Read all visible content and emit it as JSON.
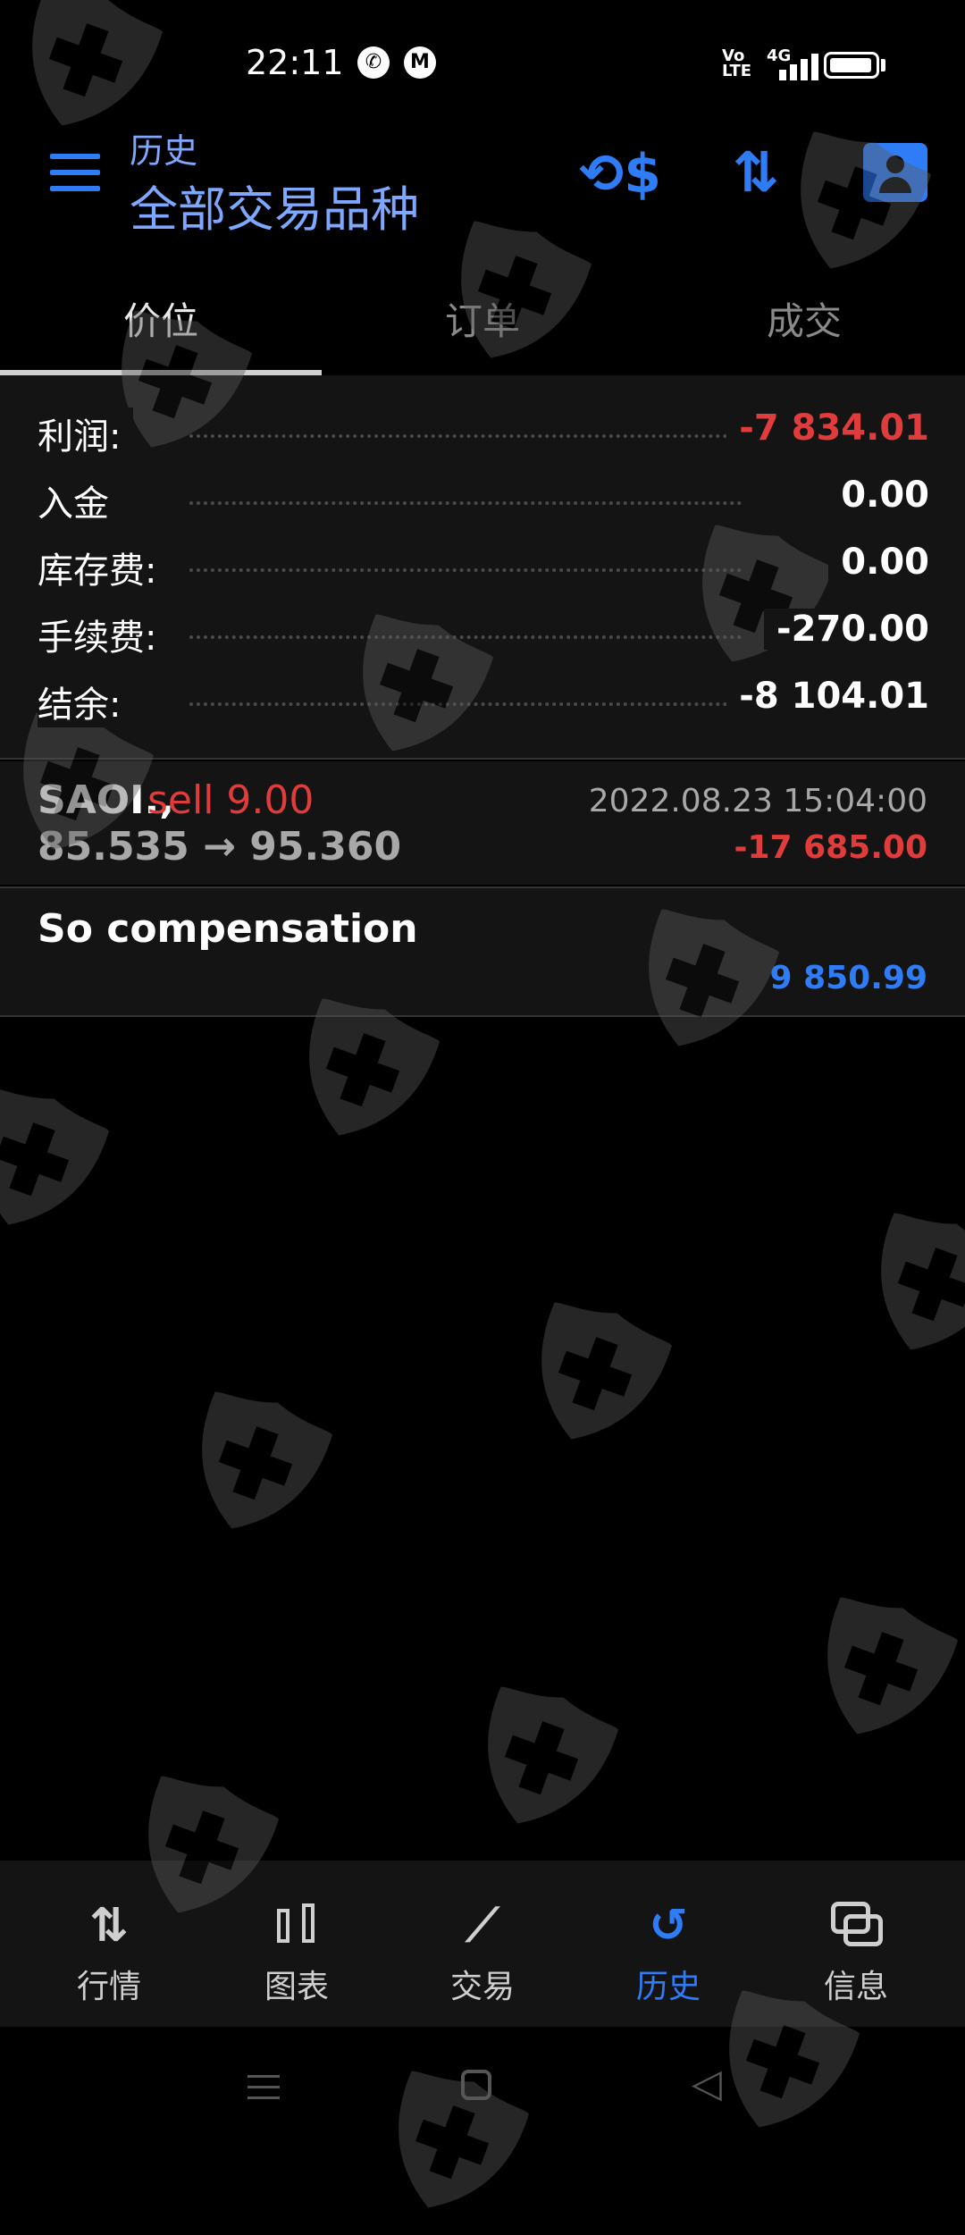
{
  "status_bar": {
    "time": "22:11",
    "network_label": "Vo\nLTE",
    "network_type": "4G",
    "icons": [
      "whatsapp-icon",
      "m-icon",
      "signal-icon",
      "battery-icon"
    ]
  },
  "header": {
    "subtitle": "历史",
    "title": "全部交易品种",
    "icons": [
      "menu-icon",
      "currency-icon",
      "sort-icon",
      "account-icon"
    ]
  },
  "tabs": [
    {
      "label": "价位",
      "active": true
    },
    {
      "label": "订单",
      "active": false
    },
    {
      "label": "成交",
      "active": false
    }
  ],
  "summary": [
    {
      "label": "利润:",
      "value": "-7 834.01",
      "color": "#e03c3c"
    },
    {
      "label": "入金",
      "value": "0.00",
      "color": "#ffffff"
    },
    {
      "label": "库存费:",
      "value": "0.00",
      "color": "#ffffff"
    },
    {
      "label": "手续费:",
      "value": "-270.00",
      "color": "#ffffff"
    },
    {
      "label": "结余:",
      "value": "-8 104.01",
      "color": "#ffffff"
    }
  ],
  "deals": [
    {
      "symbol": "SAOI.,",
      "type": "sell 9.00",
      "datetime": "2022.08.23 15:04:00",
      "prices": "85.535 → 95.360",
      "profit": "-17 685.00"
    }
  ],
  "compensation": {
    "title": "So compensation",
    "amount": "9 850.99"
  },
  "bottom_nav": [
    {
      "label": "行情",
      "icon": "quotes-icon",
      "active": false
    },
    {
      "label": "图表",
      "icon": "chart-icon",
      "active": false
    },
    {
      "label": "交易",
      "icon": "trade-icon",
      "active": false
    },
    {
      "label": "历史",
      "icon": "history-icon",
      "active": true
    },
    {
      "label": "信息",
      "icon": "messages-icon",
      "active": false
    }
  ],
  "colors": {
    "accent": "#2e7cf6",
    "negative": "#e03c3c",
    "background": "#000000",
    "panel": "#141414"
  }
}
